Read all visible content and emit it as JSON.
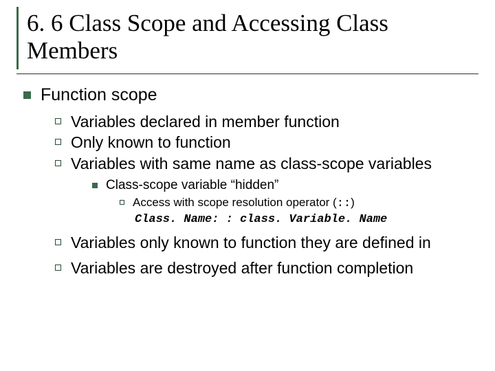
{
  "title": "6. 6 Class Scope and Accessing Class Members",
  "l1": "Function scope",
  "l2a": "Variables declared in member function",
  "l2b": "Only known to function",
  "l2c": "Variables with same name as class-scope variables",
  "l3a": "Class-scope variable “hidden”",
  "l4a_pre": "Access with scope resolution operator (",
  "l4a_code": "::",
  "l4a_post": ")",
  "code_example": "Class. Name: : class. Variable. Name",
  "l2d": "Variables only known to function they are defined in",
  "l2e": "Variables are destroyed after function completion"
}
